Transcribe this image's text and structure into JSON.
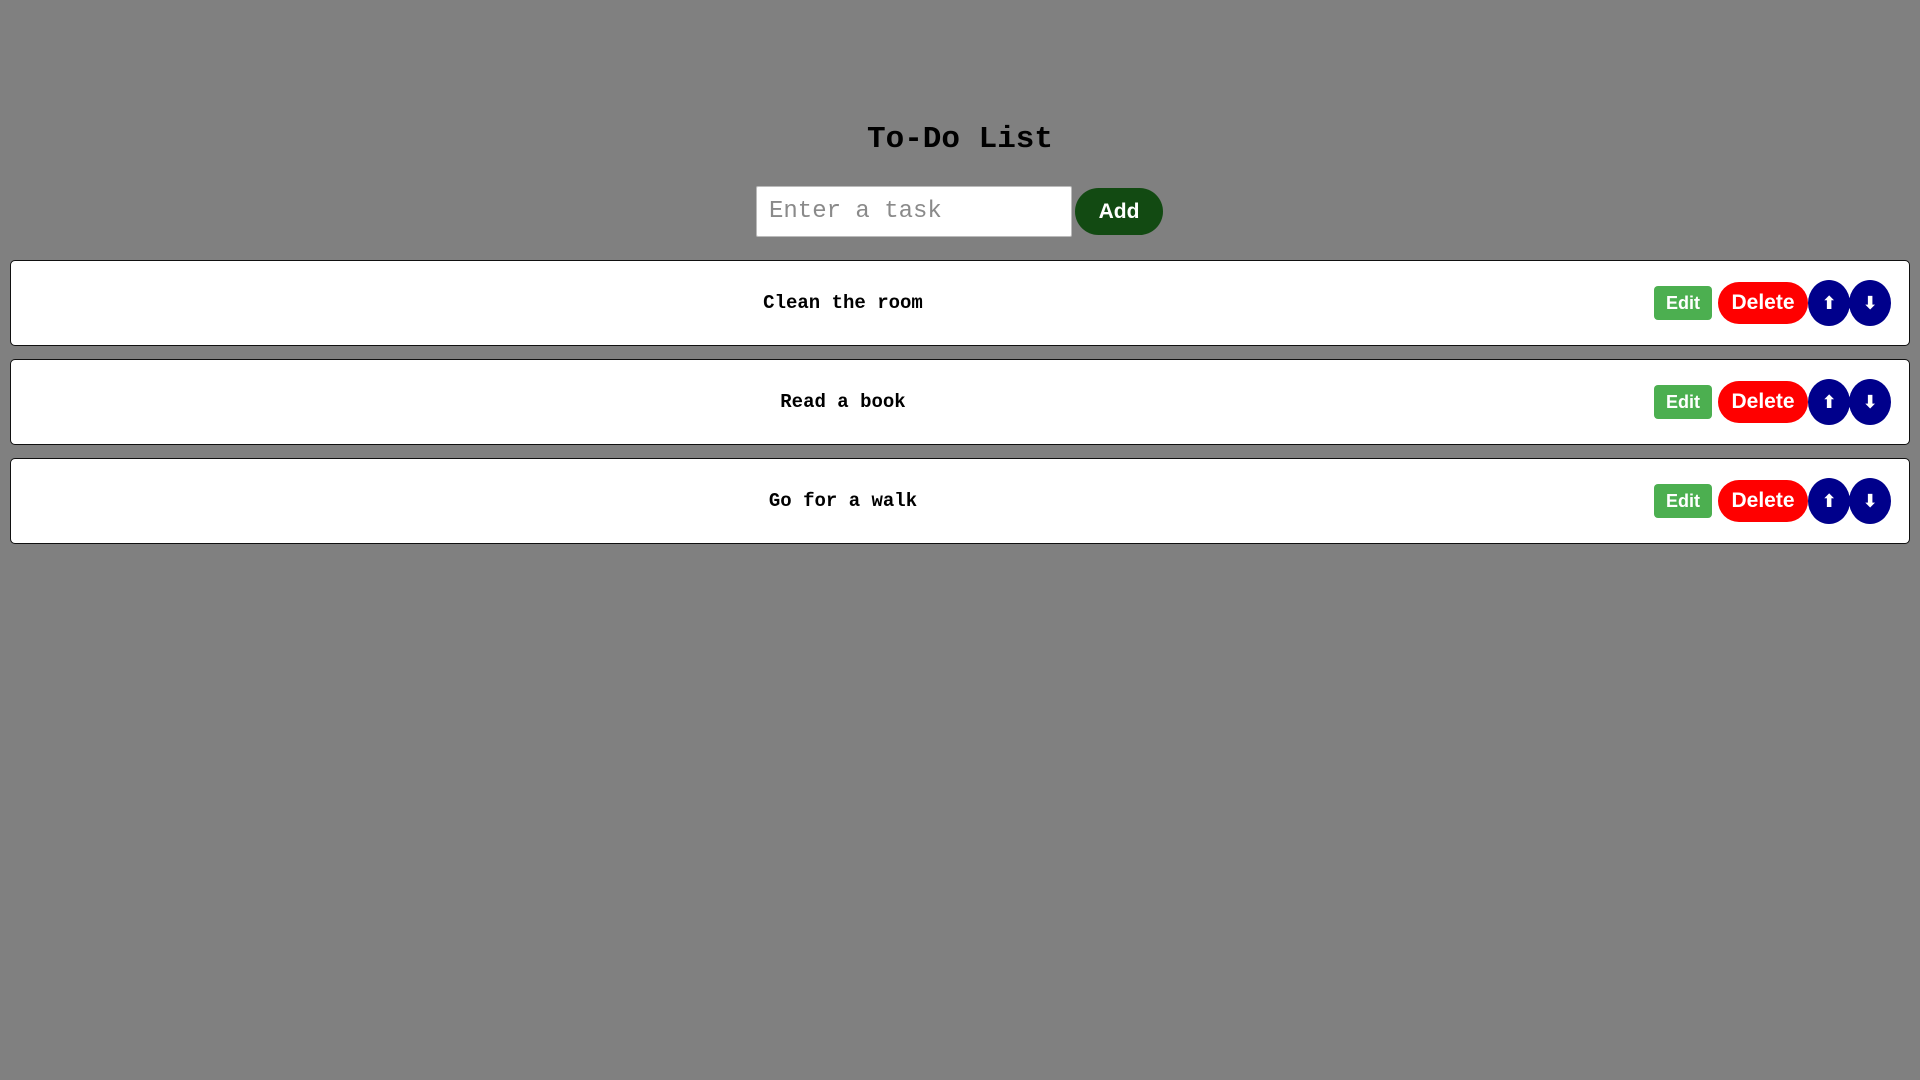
{
  "app": {
    "title": "To-Do List"
  },
  "colors": {
    "background": "#808080",
    "add_button": "#124a12",
    "edit_button": "#4caf50",
    "delete_button": "#ff0000",
    "arrow_button": "#00008b"
  },
  "add_form": {
    "input_value": "",
    "input_placeholder": "Enter a task",
    "add_label": "Add"
  },
  "tasks": [
    {
      "text": "Clean the room",
      "edit_label": "Edit",
      "delete_label": "Delete",
      "up_icon": "up-arrow-icon",
      "up_glyph": "⬆",
      "down_icon": "down-arrow-icon",
      "down_glyph": "⬇"
    },
    {
      "text": "Read a book",
      "edit_label": "Edit",
      "delete_label": "Delete",
      "up_icon": "up-arrow-icon",
      "up_glyph": "⬆",
      "down_icon": "down-arrow-icon",
      "down_glyph": "⬇"
    },
    {
      "text": "Go for a walk",
      "edit_label": "Edit",
      "delete_label": "Delete",
      "up_icon": "up-arrow-icon",
      "up_glyph": "⬆",
      "down_icon": "down-arrow-icon",
      "down_glyph": "⬇"
    }
  ]
}
